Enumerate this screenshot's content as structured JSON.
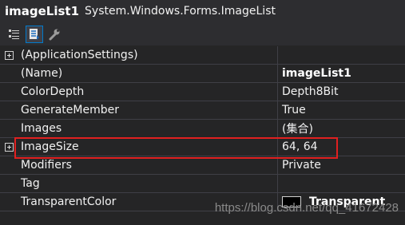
{
  "header": {
    "object_name": "imageList1",
    "object_type": "System.Windows.Forms.ImageList"
  },
  "toolbar": {
    "buttons": [
      {
        "name": "categorized-view",
        "icon": "categorized-icon"
      },
      {
        "name": "alphabetical-view",
        "icon": "alphabetical-icon",
        "active": true
      },
      {
        "name": "property-pages",
        "icon": "wrench-icon"
      }
    ]
  },
  "properties": [
    {
      "name": "(ApplicationSettings)",
      "value": "",
      "expandable": true
    },
    {
      "name": "(Name)",
      "value": "imageList1",
      "bold": true
    },
    {
      "name": "ColorDepth",
      "value": "Depth8Bit"
    },
    {
      "name": "GenerateMember",
      "value": "True"
    },
    {
      "name": "Images",
      "value": "(集合)"
    },
    {
      "name": "ImageSize",
      "value": "64, 64",
      "expandable": true,
      "highlighted": true
    },
    {
      "name": "Modifiers",
      "value": "Private"
    },
    {
      "name": "Tag",
      "value": ""
    },
    {
      "name": "TransparentColor",
      "value": "Transparent",
      "swatch": "#000000"
    }
  ],
  "colors": {
    "background": "#252526",
    "highlight_border": "#e02020",
    "accent": "#007acc"
  },
  "watermark": "https://blog.csdn.net/qq_41672428"
}
